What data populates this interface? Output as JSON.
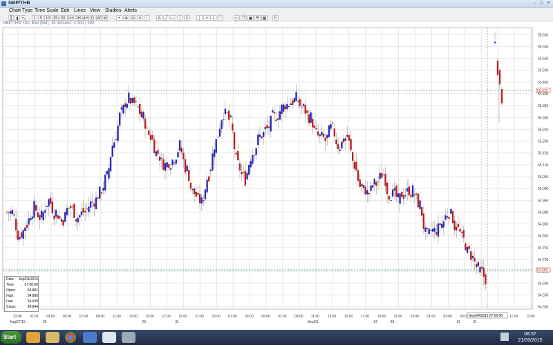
{
  "window": {
    "title": "GBP/THB",
    "min_glyph": "–",
    "max_glyph": "□",
    "close_glyph": "×"
  },
  "menu": [
    "Chart Type",
    "Time Scale",
    "Edit",
    "Lines",
    "View",
    "Studies",
    "Alerts"
  ],
  "toolbar": {
    "timeframes": [
      "1",
      "5",
      "10",
      "15",
      "30",
      "1H",
      "2H",
      "4H",
      "D",
      "W",
      "M"
    ]
  },
  "instrument_line": "GBP/THB +DC Bev (Bid), 15 minutes, # 300 | 300",
  "colors": {
    "up_bar": "#2b2bb8",
    "down_bar": "#b82020",
    "grid": "#e6e6e6",
    "hline": "#3a8a5a",
    "price_label": "#c03030"
  },
  "price_axis": {
    "ticks": [
      "55.650",
      "55.600",
      "55.550",
      "55.500",
      "55.450",
      "55.400",
      "55.350",
      "55.300",
      "55.250",
      "55.200",
      "55.150",
      "55.100",
      "55.050",
      "55.000",
      "54.950",
      "54.900",
      "54.850",
      "54.800",
      "54.750",
      "54.700",
      "54.650",
      "54.600",
      "54.550",
      "54.500"
    ],
    "marker_top": "55.415",
    "marker_bottom": "54.656"
  },
  "time_axis": {
    "hours": [
      "23:00",
      "01:00",
      "03:00",
      "05:00",
      "07:00",
      "09:00",
      "11:00",
      "13:00",
      "15:00",
      "17:00",
      "19:00",
      "21:00",
      "23:00",
      "01:00",
      "03:00",
      "05:00",
      "07:00",
      "09:00",
      "11:00",
      "13:00",
      "15:00",
      "17:00",
      "19:00",
      "21:00",
      "23:00",
      "01:00",
      "03:00",
      "05:00",
      "07:00",
      "09:00",
      "11:00",
      "13:00"
    ],
    "date_labels": [
      {
        "text": "Aug/27/15",
        "slot": 0
      },
      {
        "text": "28",
        "slot": 2
      },
      {
        "text": "29",
        "slot": 8
      },
      {
        "text": "31",
        "slot": 10
      },
      {
        "text": "Sep/01",
        "slot": 18
      },
      {
        "text": "02",
        "slot": 22
      },
      {
        "text": "03",
        "slot": 23
      },
      {
        "text": "11",
        "slot": 27
      },
      {
        "text": "21",
        "slot": 28
      }
    ],
    "cursor_label": "Sep/04/2015 07:00:00"
  },
  "data_window": {
    "rows": [
      {
        "label": "Date",
        "value": "Sep/04/2015"
      },
      {
        "label": "Time",
        "value": "07:00:00"
      },
      {
        "label": "Open:",
        "value": "54.881"
      },
      {
        "label": "High:",
        "value": "54.886"
      },
      {
        "label": "Low:",
        "value": "54.639"
      },
      {
        "label": "Close:",
        "value": "54.844"
      }
    ]
  },
  "chart_data": {
    "type": "bar",
    "title": "GBP/THB",
    "ylim": [
      54.49,
      55.68
    ],
    "series": [
      {
        "name": "GBP/THB",
        "values": [
          54.9,
          54.8,
          54.85,
          54.92,
          54.88,
          54.95,
          54.9,
          54.87,
          54.92,
          54.88,
          54.9,
          54.94,
          54.98,
          55.05,
          55.2,
          55.32,
          55.38,
          55.35,
          55.3,
          55.22,
          55.15,
          55.1,
          55.12,
          55.18,
          55.08,
          54.98,
          54.94,
          55.06,
          55.2,
          55.32,
          55.28,
          55.1,
          55.04,
          55.15,
          55.22,
          55.25,
          55.3,
          55.34,
          55.36,
          55.38,
          55.34,
          55.3,
          55.22,
          55.2,
          55.25,
          55.18,
          55.22,
          55.1,
          55.0,
          54.98,
          55.02,
          55.06,
          54.98,
          54.95,
          54.98,
          54.99,
          54.93,
          54.8,
          54.82,
          54.85,
          54.9,
          54.84,
          54.78,
          54.72,
          54.66,
          54.62
        ]
      }
    ],
    "hlines": [
      55.415,
      54.656
    ],
    "recent_spike": {
      "high": 55.66,
      "values": [
        55.62,
        55.52,
        55.48,
        55.4
      ]
    }
  },
  "taskbar": {
    "start_label": "Start",
    "time": "08:37",
    "date": "21/09/2015"
  }
}
